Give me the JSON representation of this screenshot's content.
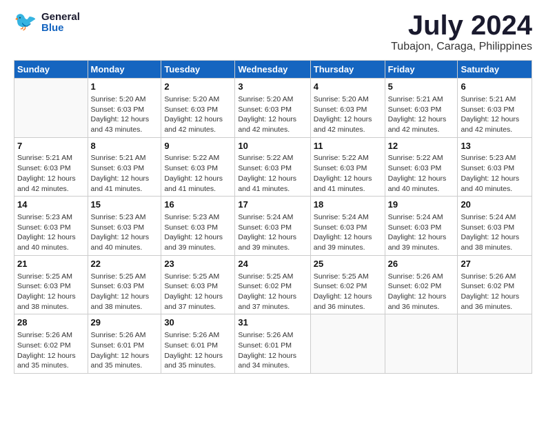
{
  "header": {
    "logo_general": "General",
    "logo_blue": "Blue",
    "month_year": "July 2024",
    "location": "Tubajon, Caraga, Philippines"
  },
  "days_of_week": [
    "Sunday",
    "Monday",
    "Tuesday",
    "Wednesday",
    "Thursday",
    "Friday",
    "Saturday"
  ],
  "weeks": [
    [
      {
        "day": "",
        "info": ""
      },
      {
        "day": "1",
        "info": "Sunrise: 5:20 AM\nSunset: 6:03 PM\nDaylight: 12 hours\nand 43 minutes."
      },
      {
        "day": "2",
        "info": "Sunrise: 5:20 AM\nSunset: 6:03 PM\nDaylight: 12 hours\nand 42 minutes."
      },
      {
        "day": "3",
        "info": "Sunrise: 5:20 AM\nSunset: 6:03 PM\nDaylight: 12 hours\nand 42 minutes."
      },
      {
        "day": "4",
        "info": "Sunrise: 5:20 AM\nSunset: 6:03 PM\nDaylight: 12 hours\nand 42 minutes."
      },
      {
        "day": "5",
        "info": "Sunrise: 5:21 AM\nSunset: 6:03 PM\nDaylight: 12 hours\nand 42 minutes."
      },
      {
        "day": "6",
        "info": "Sunrise: 5:21 AM\nSunset: 6:03 PM\nDaylight: 12 hours\nand 42 minutes."
      }
    ],
    [
      {
        "day": "7",
        "info": "Sunrise: 5:21 AM\nSunset: 6:03 PM\nDaylight: 12 hours\nand 42 minutes."
      },
      {
        "day": "8",
        "info": "Sunrise: 5:21 AM\nSunset: 6:03 PM\nDaylight: 12 hours\nand 41 minutes."
      },
      {
        "day": "9",
        "info": "Sunrise: 5:22 AM\nSunset: 6:03 PM\nDaylight: 12 hours\nand 41 minutes."
      },
      {
        "day": "10",
        "info": "Sunrise: 5:22 AM\nSunset: 6:03 PM\nDaylight: 12 hours\nand 41 minutes."
      },
      {
        "day": "11",
        "info": "Sunrise: 5:22 AM\nSunset: 6:03 PM\nDaylight: 12 hours\nand 41 minutes."
      },
      {
        "day": "12",
        "info": "Sunrise: 5:22 AM\nSunset: 6:03 PM\nDaylight: 12 hours\nand 40 minutes."
      },
      {
        "day": "13",
        "info": "Sunrise: 5:23 AM\nSunset: 6:03 PM\nDaylight: 12 hours\nand 40 minutes."
      }
    ],
    [
      {
        "day": "14",
        "info": "Sunrise: 5:23 AM\nSunset: 6:03 PM\nDaylight: 12 hours\nand 40 minutes."
      },
      {
        "day": "15",
        "info": "Sunrise: 5:23 AM\nSunset: 6:03 PM\nDaylight: 12 hours\nand 40 minutes."
      },
      {
        "day": "16",
        "info": "Sunrise: 5:23 AM\nSunset: 6:03 PM\nDaylight: 12 hours\nand 39 minutes."
      },
      {
        "day": "17",
        "info": "Sunrise: 5:24 AM\nSunset: 6:03 PM\nDaylight: 12 hours\nand 39 minutes."
      },
      {
        "day": "18",
        "info": "Sunrise: 5:24 AM\nSunset: 6:03 PM\nDaylight: 12 hours\nand 39 minutes."
      },
      {
        "day": "19",
        "info": "Sunrise: 5:24 AM\nSunset: 6:03 PM\nDaylight: 12 hours\nand 39 minutes."
      },
      {
        "day": "20",
        "info": "Sunrise: 5:24 AM\nSunset: 6:03 PM\nDaylight: 12 hours\nand 38 minutes."
      }
    ],
    [
      {
        "day": "21",
        "info": "Sunrise: 5:25 AM\nSunset: 6:03 PM\nDaylight: 12 hours\nand 38 minutes."
      },
      {
        "day": "22",
        "info": "Sunrise: 5:25 AM\nSunset: 6:03 PM\nDaylight: 12 hours\nand 38 minutes."
      },
      {
        "day": "23",
        "info": "Sunrise: 5:25 AM\nSunset: 6:03 PM\nDaylight: 12 hours\nand 37 minutes."
      },
      {
        "day": "24",
        "info": "Sunrise: 5:25 AM\nSunset: 6:02 PM\nDaylight: 12 hours\nand 37 minutes."
      },
      {
        "day": "25",
        "info": "Sunrise: 5:25 AM\nSunset: 6:02 PM\nDaylight: 12 hours\nand 36 minutes."
      },
      {
        "day": "26",
        "info": "Sunrise: 5:26 AM\nSunset: 6:02 PM\nDaylight: 12 hours\nand 36 minutes."
      },
      {
        "day": "27",
        "info": "Sunrise: 5:26 AM\nSunset: 6:02 PM\nDaylight: 12 hours\nand 36 minutes."
      }
    ],
    [
      {
        "day": "28",
        "info": "Sunrise: 5:26 AM\nSunset: 6:02 PM\nDaylight: 12 hours\nand 35 minutes."
      },
      {
        "day": "29",
        "info": "Sunrise: 5:26 AM\nSunset: 6:01 PM\nDaylight: 12 hours\nand 35 minutes."
      },
      {
        "day": "30",
        "info": "Sunrise: 5:26 AM\nSunset: 6:01 PM\nDaylight: 12 hours\nand 35 minutes."
      },
      {
        "day": "31",
        "info": "Sunrise: 5:26 AM\nSunset: 6:01 PM\nDaylight: 12 hours\nand 34 minutes."
      },
      {
        "day": "",
        "info": ""
      },
      {
        "day": "",
        "info": ""
      },
      {
        "day": "",
        "info": ""
      }
    ]
  ]
}
